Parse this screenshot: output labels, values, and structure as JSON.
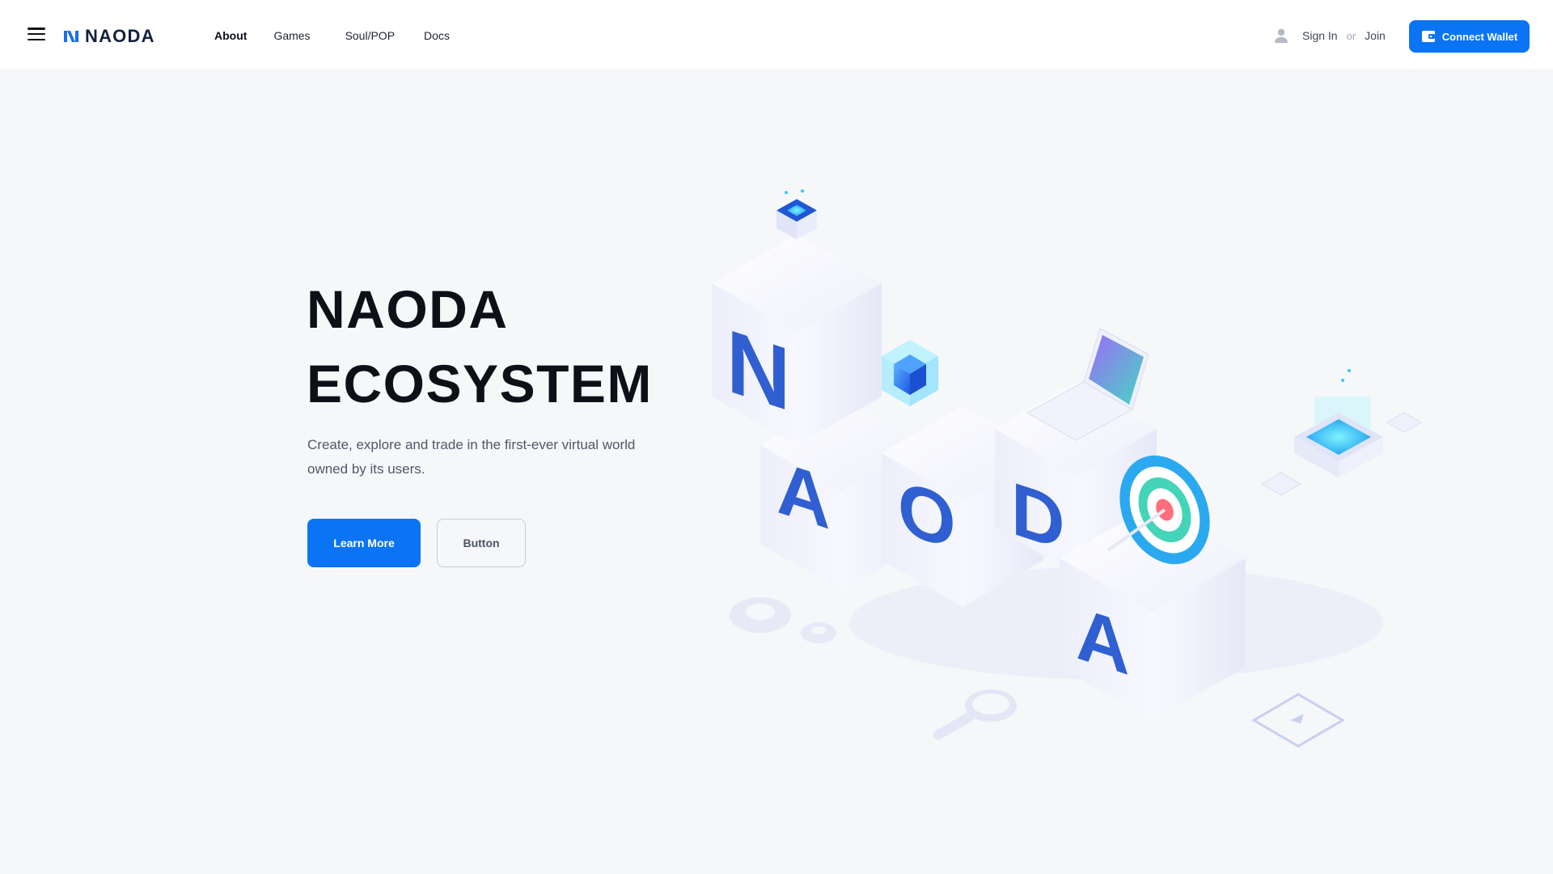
{
  "header": {
    "logo_text": "NAODA",
    "nav": [
      {
        "label": "About",
        "active": true
      },
      {
        "label": "Games",
        "active": false
      },
      {
        "label": "Soul/POP",
        "active": false
      },
      {
        "label": "Docs",
        "active": false
      }
    ],
    "sign_in": "Sign In",
    "or": "or",
    "join": "Join",
    "connect_wallet": "Connect Wallet",
    "icons": [
      "hamburger-menu-icon",
      "user-icon",
      "wallet-icon"
    ]
  },
  "hero": {
    "title_line1": "NAODA",
    "title_line2": "ECOSYSTEM",
    "description": "Create, explore and trade in the first-ever virtual world owned by its users.",
    "primary_button": "Learn More",
    "secondary_button": "Button"
  },
  "illustration": {
    "letters": [
      "N",
      "A",
      "O",
      "D",
      "A"
    ]
  },
  "colors": {
    "accent": "#0a74f5",
    "background": "#f6f7f9",
    "letter_blue": "#2f5fd0"
  }
}
